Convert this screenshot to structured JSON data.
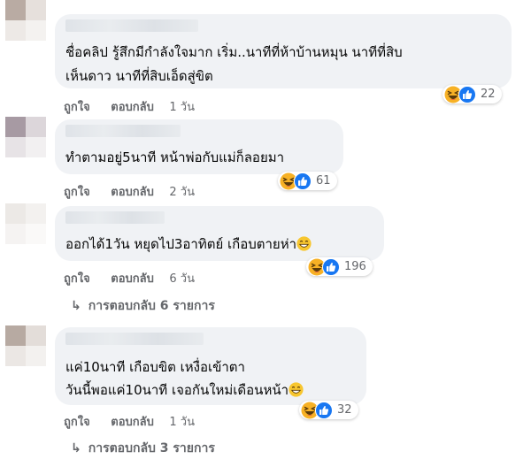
{
  "comments": [
    {
      "text_lines": [
        "ชื่อคลิป รู้สึกมีกำลังใจมาก เริ่ม..นาทีที่ห้าบ้านหมุน นาทีที่สิบ",
        "เห็นดาว นาทีที่สิบเอ็ดสู่ขิต"
      ],
      "actions": {
        "like": "ถูกใจ",
        "reply": "ตอบกลับ",
        "time": "1 วัน"
      },
      "reactions": {
        "icons": [
          "haha-icon",
          "like-icon"
        ],
        "count": "22"
      }
    },
    {
      "text_lines": [
        "ทำตามอยู่5นาที หน้าพ่อกับแม่ก็ลอยมา"
      ],
      "actions": {
        "like": "ถูกใจ",
        "reply": "ตอบกลับ",
        "time": "2 วัน"
      },
      "reactions": {
        "icons": [
          "haha-icon",
          "like-icon"
        ],
        "count": "61"
      }
    },
    {
      "text_lines": [
        "ออกได้1วัน หยุดไป3อาทิตย์ เกือบตายห่า"
      ],
      "actions": {
        "like": "ถูกใจ",
        "reply": "ตอบกลับ",
        "time": "6 วัน"
      },
      "reactions": {
        "icons": [
          "haha-icon",
          "like-icon"
        ],
        "count": "196"
      },
      "view_replies": "การตอบกลับ 6 รายการ"
    },
    {
      "text_lines": [
        "แค่10นาที เกือบขิต เหงื่อเข้าตา",
        "วันนี้พอแค่10นาที เจอกันใหม่เดือนหน้า"
      ],
      "actions": {
        "like": "ถูกใจ",
        "reply": "ตอบกลับ",
        "time": "1 วัน"
      },
      "reactions": {
        "icons": [
          "haha-icon",
          "like-icon"
        ],
        "count": "32"
      },
      "view_replies": "การตอบกลับ 3 รายการ"
    }
  ],
  "colors": {
    "bubble": "#f0f2f5",
    "meta_text": "#65676b",
    "like_blue": "#1877f2",
    "haha_yellow": "#f7b125"
  }
}
